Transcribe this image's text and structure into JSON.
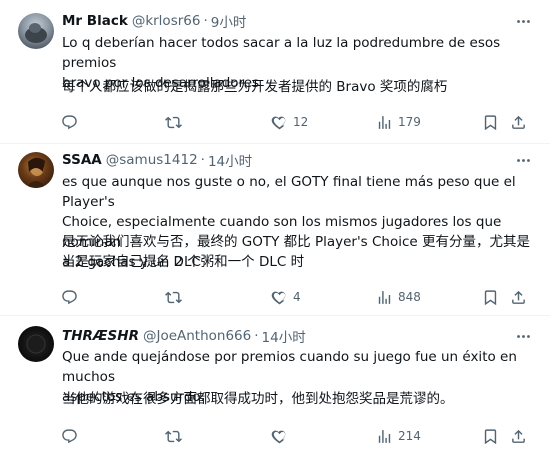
{
  "tweets": [
    {
      "name": "Mr Black",
      "handle": "@krlosr66",
      "time": "9小时",
      "text": "Lo q deberían hacer todos sacar a la luz la podredumbre de esos premios\nbravo por los desarrolladores",
      "translation": "每个人都应该做的是揭露那些为开发者提供的 Bravo 奖项的腐朽",
      "likes": "12",
      "views": "179"
    },
    {
      "name": "SSAA",
      "handle": "@samus1412",
      "time": "14小时",
      "text": "es que aunque nos guste o no, el GOTY final tiene más peso que el Player's\nChoice, especialmente cuando son los mismos jugadores los que nominan\na 2 gachas y un DLC",
      "translation": "是无论我们喜欢与否，最终的 GOTY 都比 Player's Choice 更有分量，尤其是当是玩家自己提名 2 个粥和一个 DLC 时",
      "likes": "4",
      "views": "848"
    },
    {
      "name": "THRÆSHR",
      "handle": "@JoeAnthon666",
      "time": "14小时",
      "text": "Que ande quejándose por premios cuando su juego fue un éxito en muchos\naspectos es absurdo.",
      "translation": "当他的游戏在很多方面都取得成功时，他到处抱怨奖品是荒谬的。",
      "likes": "",
      "views": "214"
    }
  ],
  "colors": {
    "text": "#0f1419",
    "muted": "#536471",
    "divider": "#eff3f4"
  },
  "icons": [
    "more-icon",
    "reply-icon",
    "retweet-icon",
    "like-icon",
    "views-icon",
    "bookmark-icon",
    "share-icon"
  ]
}
